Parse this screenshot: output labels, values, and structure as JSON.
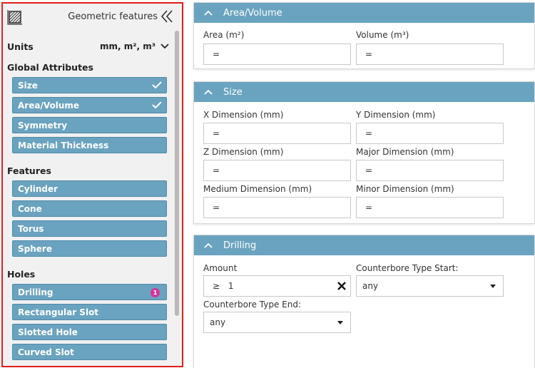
{
  "sidebar": {
    "title": "Geometric features",
    "units": {
      "label": "Units",
      "value": "mm, m², m³"
    },
    "sections": {
      "global": "Global Attributes",
      "features": "Features",
      "holes": "Holes"
    },
    "global_items": [
      {
        "label": "Size",
        "checked": true
      },
      {
        "label": "Area/Volume",
        "checked": true
      },
      {
        "label": "Symmetry",
        "checked": false
      },
      {
        "label": "Material Thickness",
        "checked": false
      }
    ],
    "feature_items": [
      {
        "label": "Cylinder"
      },
      {
        "label": "Cone"
      },
      {
        "label": "Torus"
      },
      {
        "label": "Sphere"
      }
    ],
    "hole_items": [
      {
        "label": "Drilling",
        "badge": "1"
      },
      {
        "label": "Rectangular Slot"
      },
      {
        "label": "Slotted Hole"
      },
      {
        "label": "Curved Slot"
      }
    ]
  },
  "panels": {
    "area_volume": {
      "title": "Area/Volume",
      "area_label": "Area (m²)",
      "area_value": "=",
      "volume_label": "Volume (m³)",
      "volume_value": "="
    },
    "size": {
      "title": "Size",
      "x_label": "X Dimension (mm)",
      "x_value": "=",
      "y_label": "Y Dimension (mm)",
      "y_value": "=",
      "z_label": "Z Dimension (mm)",
      "z_value": "=",
      "major_label": "Major Dimension (mm)",
      "major_value": "=",
      "medium_label": "Medium Dimension (mm)",
      "medium_value": "=",
      "minor_label": "Minor Dimension (mm)",
      "minor_value": "="
    },
    "drilling": {
      "title": "Drilling",
      "amount_label": "Amount",
      "amount_operator": "≥",
      "amount_value": "1",
      "cb_start_label": "Counterbore Type Start:",
      "cb_start_value": "any",
      "cb_end_label": "Counterbore Type End:",
      "cb_end_value": "any"
    }
  },
  "colors": {
    "accent": "#6aa3bf",
    "badge": "#d1369b",
    "highlight_border": "#e11d1d"
  }
}
